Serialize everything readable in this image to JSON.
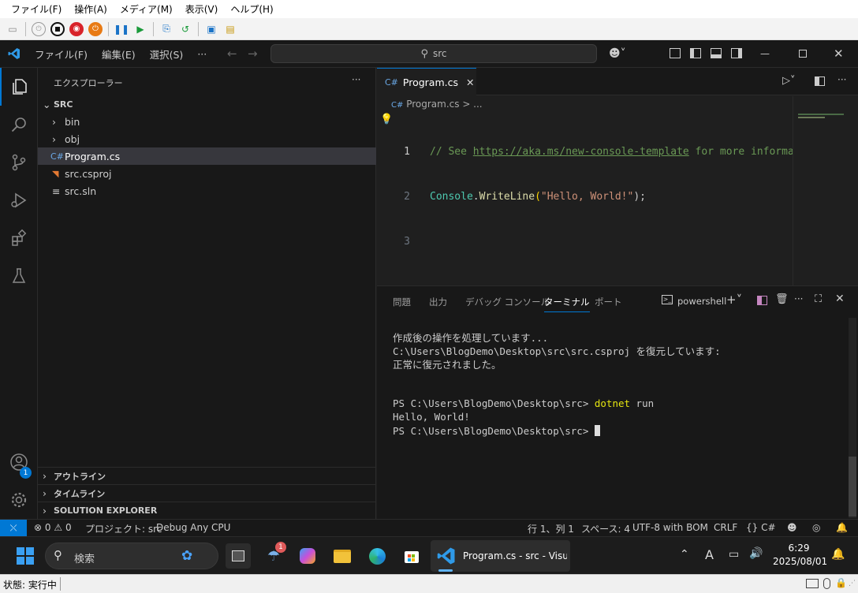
{
  "host": {
    "menu": [
      "ファイル(F)",
      "操作(A)",
      "メディア(M)",
      "表示(V)",
      "ヘルプ(H)"
    ],
    "status": "状態: 実行中"
  },
  "titlebar": {
    "menus": [
      "ファイル(F)",
      "編集(E)",
      "選択(S)",
      "···"
    ],
    "search": "src"
  },
  "sidebar": {
    "title": "エクスプローラー",
    "root": "SRC",
    "items": [
      {
        "label": "bin",
        "type": "folder"
      },
      {
        "label": "obj",
        "type": "folder"
      },
      {
        "label": "Program.cs",
        "type": "cs"
      },
      {
        "label": "src.csproj",
        "type": "rss"
      },
      {
        "label": "src.sln",
        "type": "sln"
      }
    ],
    "sections": [
      "アウトライン",
      "タイムライン",
      "SOLUTION EXPLORER"
    ]
  },
  "editor": {
    "tab": "Program.cs",
    "breadcrumb": "Program.cs > ...",
    "lines": [
      {
        "no": "1",
        "comment_prefix": "// See ",
        "link": "https://aka.ms/new-console-template",
        "comment_suffix": " for more informat"
      },
      {
        "no": "2",
        "obj": "Console",
        "dot": ".",
        "method": "WriteLine",
        "open": "(",
        "str": "\"Hello, World!\"",
        "close": ");"
      },
      {
        "no": "3"
      }
    ]
  },
  "panel": {
    "tabs": [
      "問題",
      "出力",
      "デバッグ コンソール",
      "ターミナル",
      "ポート"
    ],
    "shell": "powershell",
    "lines": [
      "作成後の操作を処理しています...",
      "C:\\Users\\BlogDemo\\Desktop\\src\\src.csproj を復元しています:",
      "正常に復元されました。",
      "",
      "",
      "PS C:\\Users\\BlogDemo\\Desktop\\src> ",
      "Hello, World!",
      "PS C:\\Users\\BlogDemo\\Desktop\\src> "
    ],
    "cmd1": "dotnet",
    "cmd2": " run"
  },
  "status": {
    "errors": "0",
    "warnings": "0",
    "project": "プロジェクト: src",
    "config": "Debug Any CPU",
    "position": "行 1、列 1",
    "spaces": "スペース: 4",
    "encoding": "UTF-8 with BOM",
    "eol": "CRLF",
    "lang": "C#",
    "account_badge": "1"
  },
  "taskbar": {
    "search": "検索",
    "app": "Program.cs - src - Visua",
    "time": "6:29",
    "date": "2025/08/01",
    "notif_badge": "1"
  },
  "colors": {
    "accent": "#0078d4",
    "bg": "#1f1f1f",
    "sidebar": "#181818"
  }
}
